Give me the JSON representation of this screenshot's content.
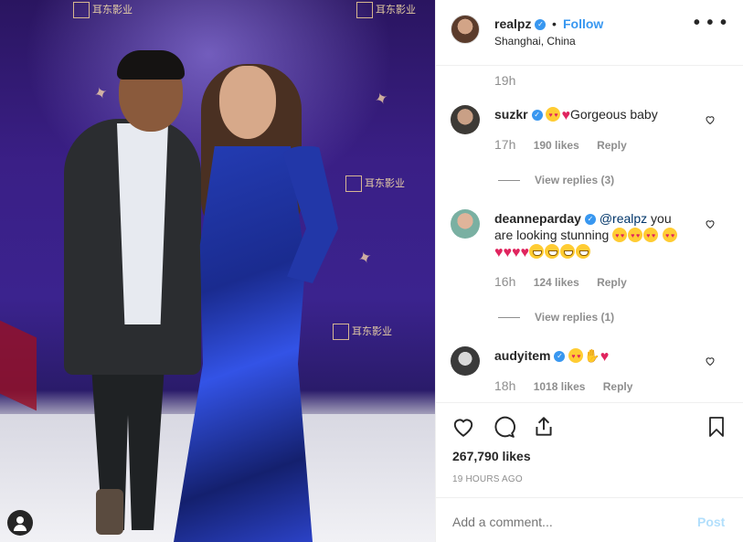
{
  "post": {
    "username": "realpz",
    "follow_label": "Follow",
    "dot": "•",
    "location": "Shanghai, China",
    "caption_time": "19h",
    "likes": "267,790 likes",
    "posted": "19 HOURS AGO",
    "more_label": "•••"
  },
  "comments": [
    {
      "username": "suzkr",
      "text": "Gorgeous baby",
      "time": "17h",
      "likes": "190 likes",
      "reply": "Reply",
      "view_replies": "View replies (3)"
    },
    {
      "username": "deanneparday",
      "mention": "@realpz",
      "text": " you are looking stunning",
      "time": "16h",
      "likes": "124 likes",
      "reply": "Reply",
      "view_replies": "View replies (1)"
    },
    {
      "username": "audyitem",
      "text": "",
      "time": "18h",
      "likes": "1018 likes",
      "reply": "Reply"
    }
  ],
  "composer": {
    "placeholder": "Add a comment...",
    "post_label": "Post"
  },
  "photo_logo": "耳东影业",
  "colors": {
    "accent": "#3897f0",
    "muted": "#8e8e8e",
    "post_disabled": "#b2dffc",
    "heart": "#e0245e"
  },
  "icons": [
    "verified-icon",
    "more-icon",
    "heart-icon",
    "comment-icon",
    "share-icon",
    "bookmark-icon",
    "user-tag-icon"
  ]
}
